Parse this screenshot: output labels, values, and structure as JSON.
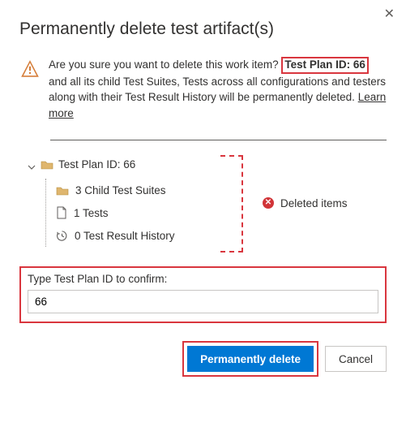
{
  "dialog": {
    "title": "Permanently delete test artifact(s)",
    "warning_prefix": "Are you sure you want to delete this work item?",
    "highlighted_id": "Test Plan ID: 66",
    "warning_suffix": " and all its child Test Suites, Tests across all configurations and testers along with their Test Result History will be permanently deleted. ",
    "learn_more": "Learn more"
  },
  "tree": {
    "root": "Test Plan ID: 66",
    "children": [
      "3 Child Test Suites",
      "1 Tests",
      "0 Test Result History"
    ],
    "deleted_label": "Deleted items"
  },
  "confirm": {
    "label": "Type Test Plan ID to confirm:",
    "value": "66"
  },
  "footer": {
    "primary": "Permanently delete",
    "cancel": "Cancel"
  }
}
